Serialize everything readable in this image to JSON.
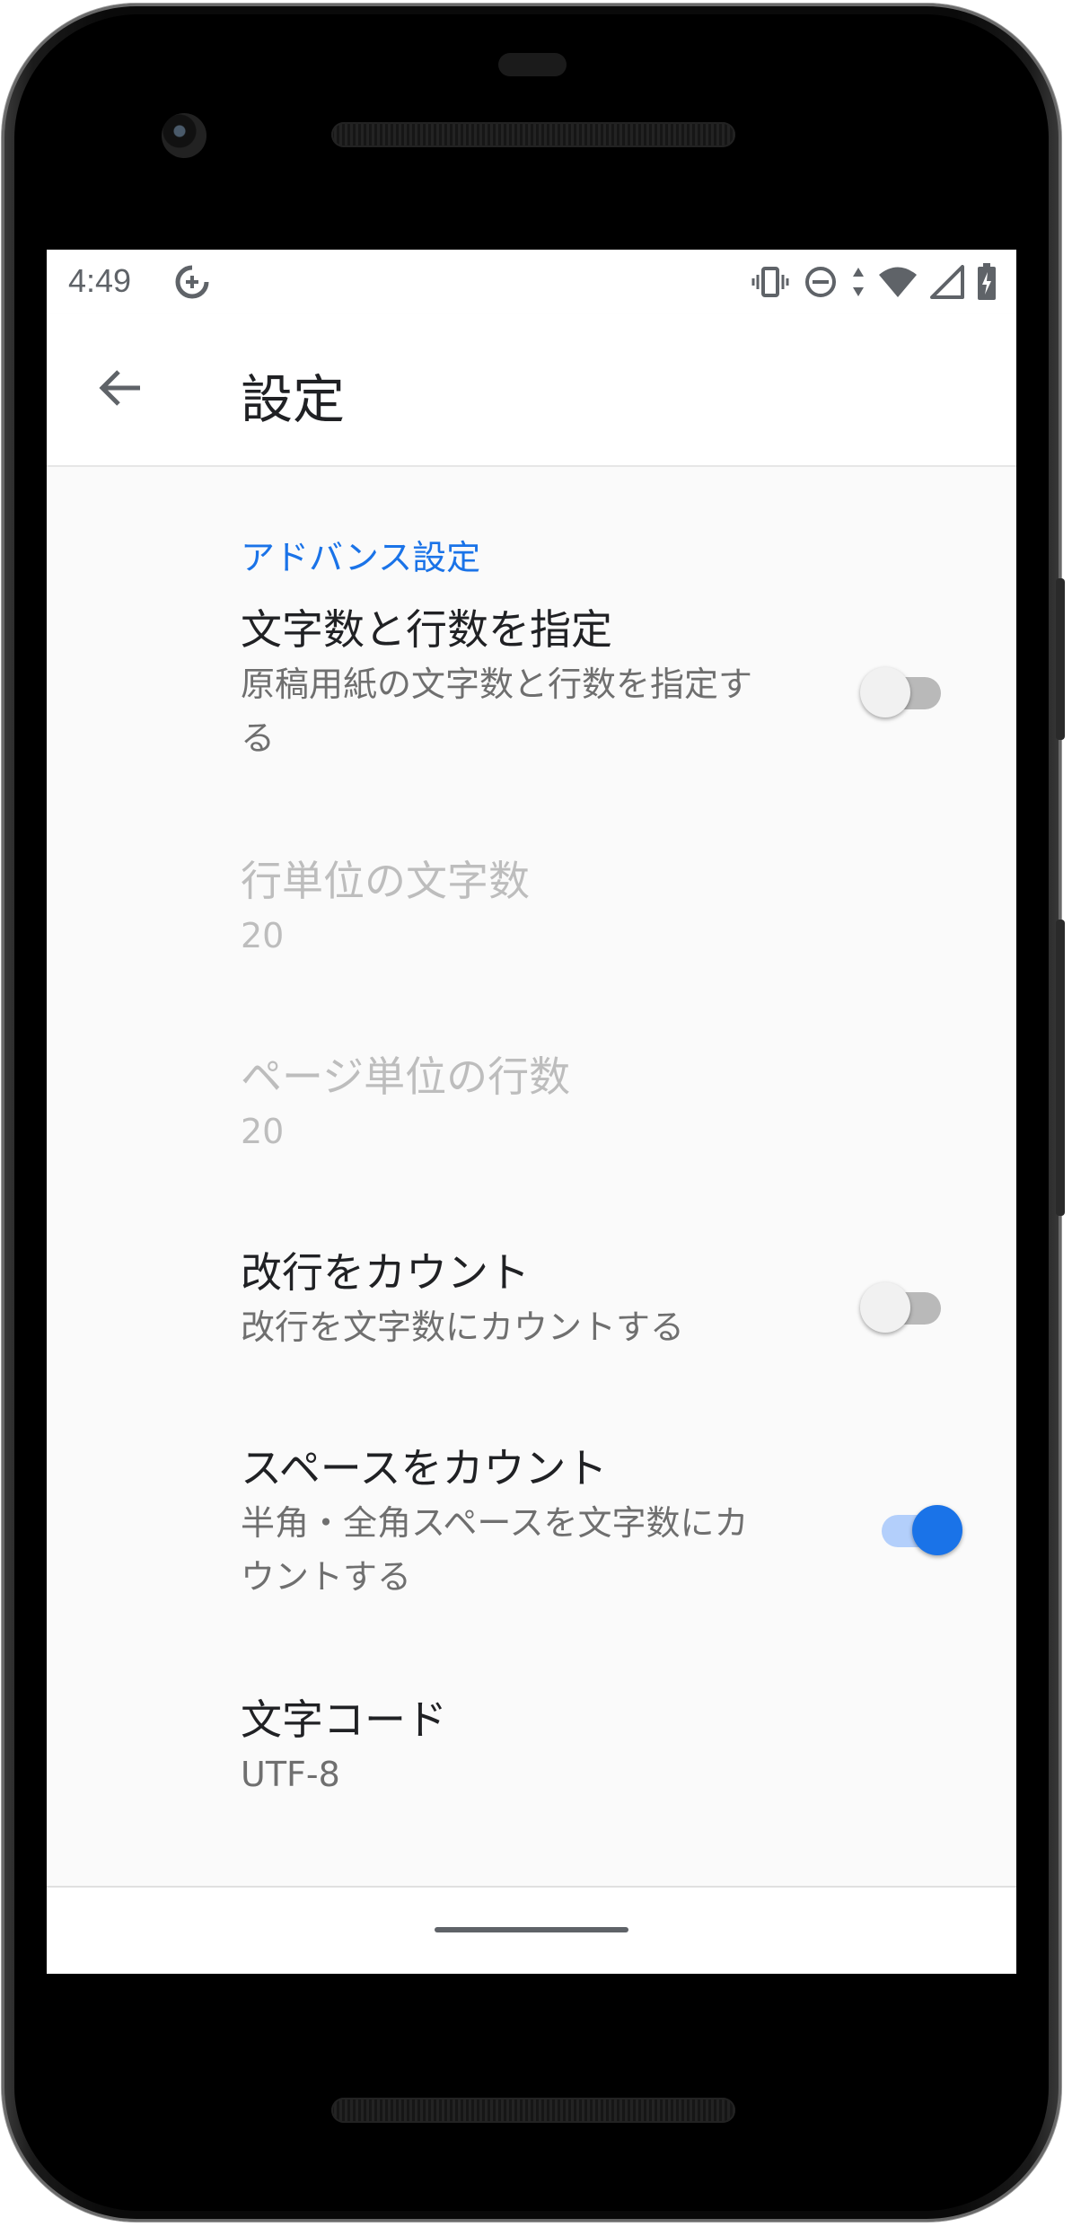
{
  "status_bar": {
    "time": "4:49",
    "icons": [
      "data-saver-icon",
      "vibrate-icon",
      "do-not-disturb-icon",
      "data-arrows-icon",
      "wifi-icon",
      "signal-icon",
      "battery-icon"
    ]
  },
  "app_bar": {
    "back_icon": "arrow-back-icon",
    "title": "設定"
  },
  "section": {
    "header": "アドバンス設定"
  },
  "preferences": [
    {
      "title": "文字数と行数を指定",
      "summary": "原稿用紙の文字数と行数を指定する",
      "enabled": true,
      "switch": false
    },
    {
      "title": "行単位の文字数",
      "summary": "20",
      "enabled": false
    },
    {
      "title": "ページ単位の行数",
      "summary": "20",
      "enabled": false
    },
    {
      "title": "改行をカウント",
      "summary": "改行を文字数にカウントする",
      "enabled": true,
      "switch": false
    },
    {
      "title": "スペースをカウント",
      "summary": "半角・全角スペースを文字数にカウントする",
      "enabled": true,
      "switch": true
    },
    {
      "title": "文字コード",
      "summary": "UTF-8",
      "enabled": true
    }
  ],
  "colors": {
    "accent": "#1a73e8",
    "accent_track": "#b3cffb",
    "text_primary": "#202124",
    "text_secondary": "#6f6f6f",
    "text_disabled": "#bdbdbd"
  }
}
